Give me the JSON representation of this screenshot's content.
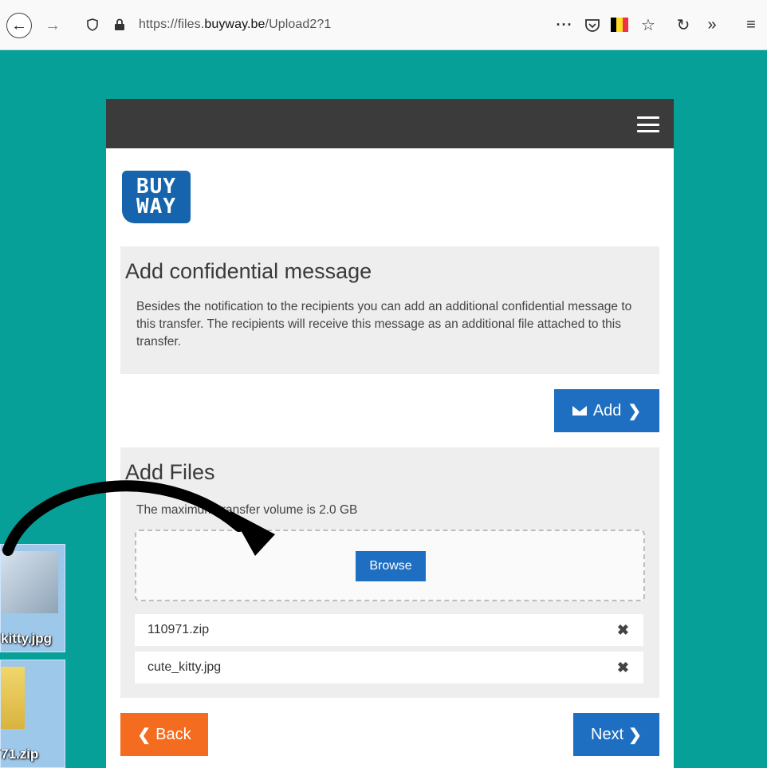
{
  "browser": {
    "url_prefix": "https://files.",
    "url_domain": "buyway.be",
    "url_path": "/Upload2?1",
    "icons": [
      "back-icon",
      "forward-icon",
      "shield-icon",
      "lock-icon",
      "more-icon",
      "pocket-icon",
      "belgium-flag-icon",
      "star-icon",
      "reload-icon",
      "overflow-icon",
      "menu-icon"
    ],
    "flag_colors": [
      "#000000",
      "#fdda24",
      "#ef3340"
    ]
  },
  "logo": {
    "line1": "BUY",
    "line2": "WAY"
  },
  "message_section": {
    "title": "Add confidential message",
    "description": "Besides the notification to the recipients you can add an additional confidential message to this transfer. The recipients will receive this message as an additional file attached to this transfer.",
    "add_label": "Add"
  },
  "files_section": {
    "title": "Add Files",
    "max_volume": "The maximum transfer volume is 2.0 GB",
    "browse_label": "Browse",
    "files": [
      "110971.zip",
      "cute_kitty.jpg"
    ]
  },
  "nav": {
    "back_label": "Back",
    "next_label": "Next"
  },
  "desktop": {
    "icon1_label": "kitty.jpg",
    "icon2_label": "71.zip"
  },
  "colors": {
    "background": "#07a098",
    "primary": "#1e6fc1",
    "back": "#f36c1f",
    "header": "#3b3b3b"
  }
}
